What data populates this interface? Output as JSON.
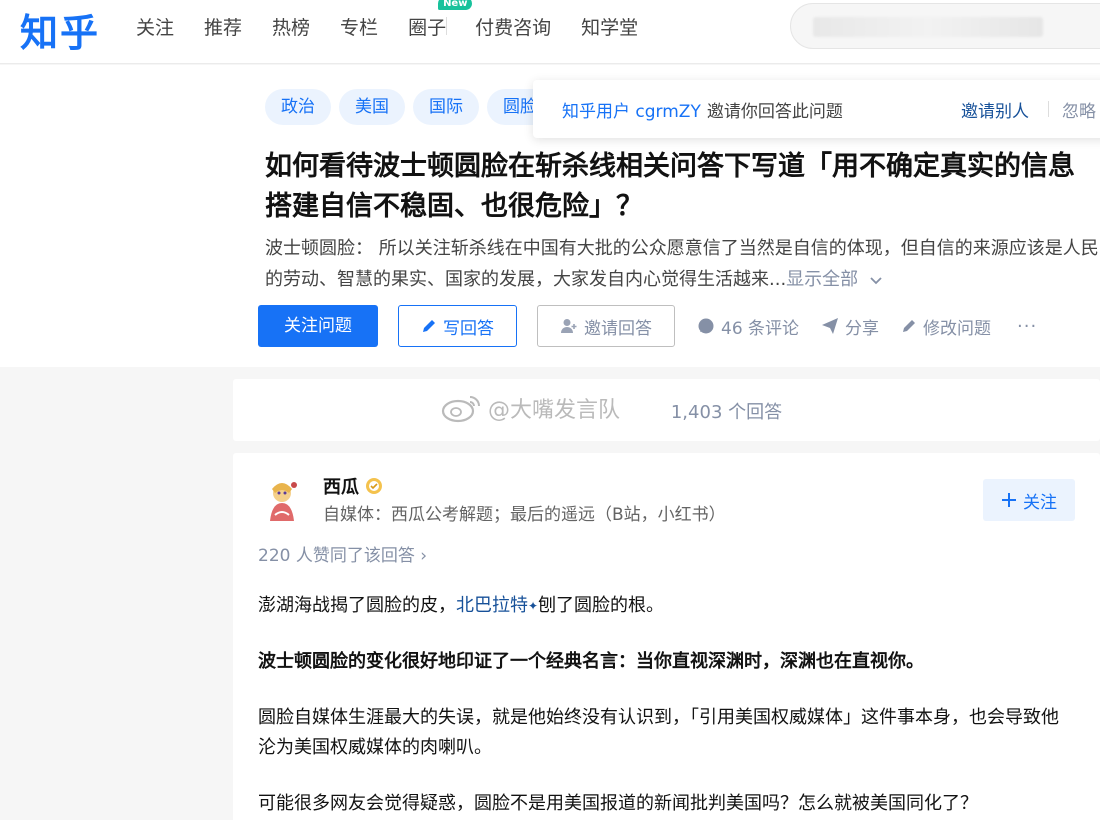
{
  "header": {
    "logo": "知乎",
    "nav": [
      {
        "label": "关注"
      },
      {
        "label": "推荐"
      },
      {
        "label": "热榜"
      },
      {
        "label": "专栏"
      },
      {
        "label": "圈子",
        "badge": "New"
      },
      {
        "label": "付费咨询"
      },
      {
        "label": "知学堂"
      }
    ]
  },
  "question": {
    "topics": [
      "政治",
      "美国",
      "国际",
      "圆脸"
    ],
    "title": "如何看待波士顿圆脸在斩杀线相关问答下写道「用不确定真实的信息搭建自信不稳固、也很危险」？",
    "excerpt": "波士顿圆脸： 所以关注斩杀线在中国有大批的公众愿意信了当然是自信的体现，但自信的来源应该是人民的劳动、智慧的果实、国家的发展，大家发自内心觉得生活越来...",
    "show_all": "显示全部",
    "follow_label": "关注问题",
    "answer_label": "写回答",
    "invite_label": "邀请回答",
    "comments_label": "46 条评论",
    "share_label": "分享",
    "edit_label": "修改问题",
    "more_label": "···"
  },
  "invite_popup": {
    "user": "知乎用户 cgrmZY",
    "text": "邀请你回答此问题",
    "invite_others": "邀请别人",
    "ignore": "忽略"
  },
  "answers_bar": {
    "count_text": "1,403 个回答",
    "watermark": "@大嘴发言队"
  },
  "answer": {
    "author": "西瓜",
    "headline": "自媒体：西瓜公考解题；最后的遥远（B站，小红书）",
    "follow_label": "关注",
    "votes": "220 人赞同了该回答 ›",
    "p1_before": "澎湖海战揭了圆脸的皮，",
    "p1_link": "北巴拉特",
    "p1_after": "刨了圆脸的根。",
    "p2": "波士顿圆脸的变化很好地印证了一个经典名言：当你直视深渊时，深渊也在直视你。",
    "p3": "圆脸自媒体生涯最大的失误，就是他始终没有认识到，「引用美国权威媒体」这件事本身，也会导致他沦为美国权威媒体的肉喇叭。",
    "p4": "可能很多网友会觉得疑惑，圆脸不是用美国报道的新闻批判美国吗？怎么就被美国同化了？"
  }
}
